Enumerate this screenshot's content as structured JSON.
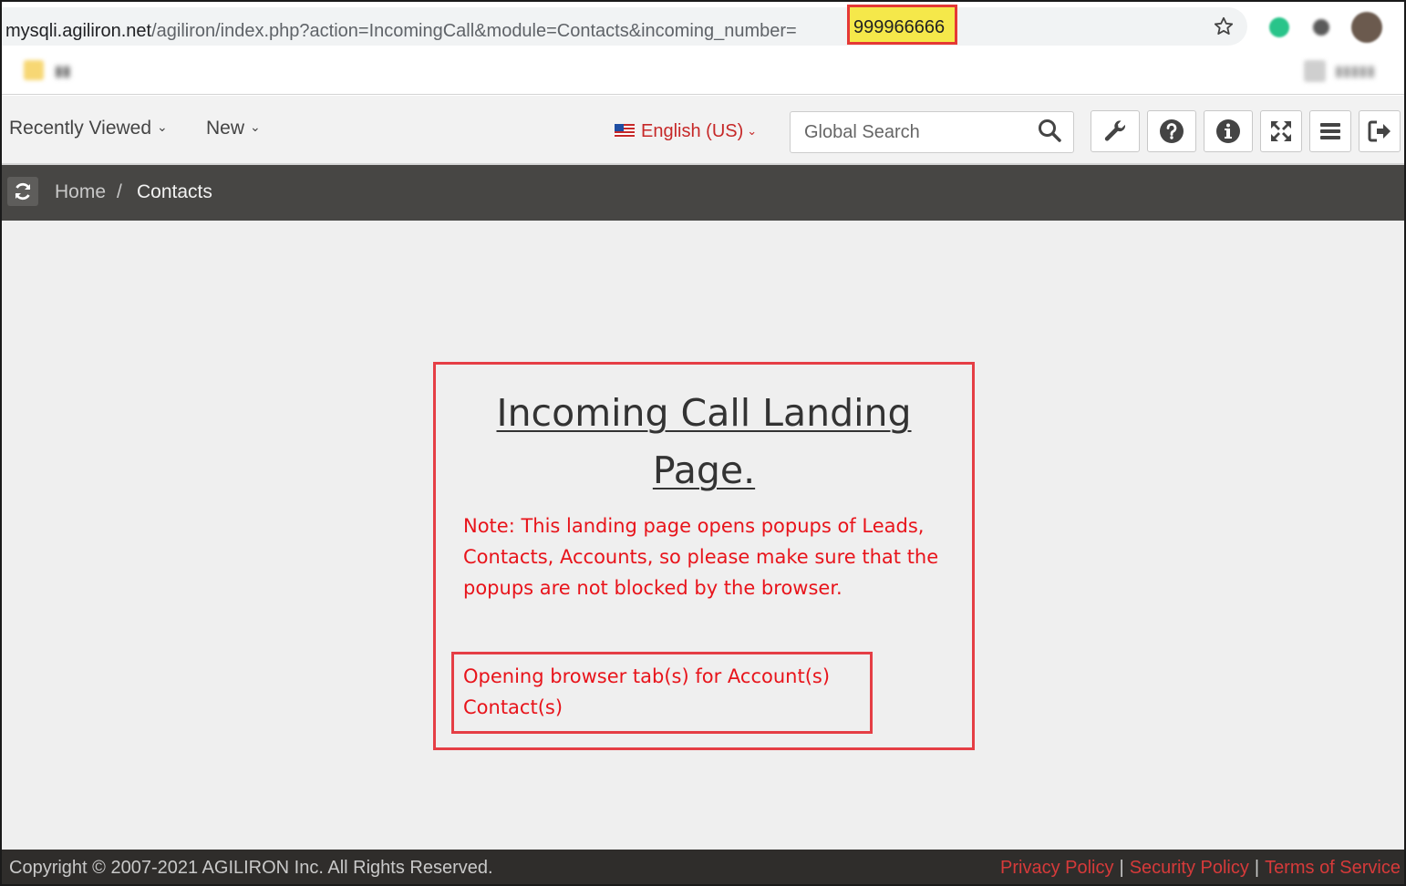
{
  "browser": {
    "url_host": "mysqli.agiliron.net",
    "url_path": "/agiliron/index.php?action=IncomingCall&module=Contacts&incoming_number=",
    "url_highlighted_number": "999966666"
  },
  "toolbar": {
    "recently_viewed_label": "Recently Viewed",
    "new_label": "New",
    "language_label": "English (US)",
    "search_placeholder": "Global Search"
  },
  "breadcrumb": {
    "home": "Home",
    "separator": "/",
    "current": "Contacts"
  },
  "panel": {
    "heading": "Incoming Call Landing Page.",
    "note": "Note: This landing page opens popups of Leads, Contacts, Accounts, so please make sure that the popups are not blocked by the browser.",
    "opening_line1": "Opening browser tab(s) for Account(s)",
    "opening_line2": "Contact(s)"
  },
  "footer": {
    "copyright": "Copyright © 2007-2021 AGILIRON Inc. All Rights Reserved.",
    "privacy": "Privacy Policy",
    "security": "Security Policy",
    "terms": "Terms of Service",
    "separator": "|"
  },
  "colors": {
    "accent_red": "#e8141b",
    "highlight_yellow": "#f5e84a",
    "breadcrumb_bg": "#474644",
    "footer_bg": "#2f2d2b"
  },
  "icons": [
    "star-icon",
    "search-icon",
    "wrench-icon",
    "help-icon",
    "info-icon",
    "fullscreen-icon",
    "menu-icon",
    "logout-icon",
    "refresh-icon",
    "flag-icon",
    "chevron-down-icon"
  ]
}
